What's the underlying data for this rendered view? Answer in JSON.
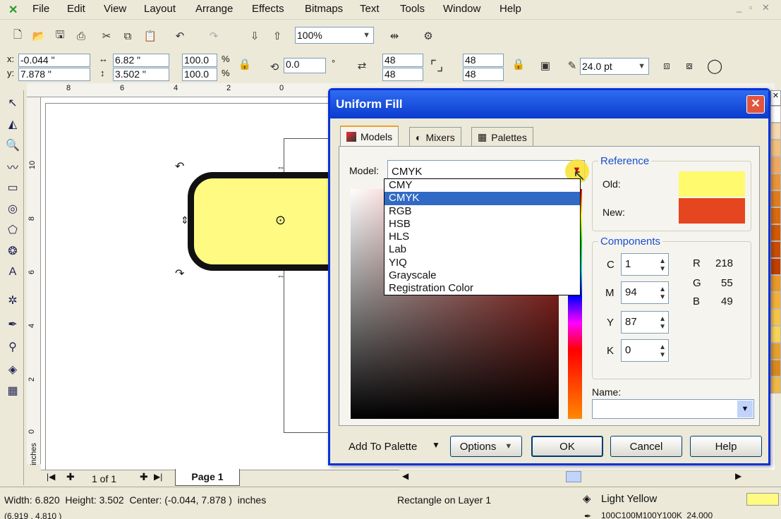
{
  "menu": [
    "File",
    "Edit",
    "View",
    "Layout",
    "Arrange",
    "Effects",
    "Bitmaps",
    "Text",
    "Tools",
    "Window",
    "Help"
  ],
  "toolbar": {
    "zoom": "100%"
  },
  "propbar": {
    "x_label": "x:",
    "x": "-0.044 \"",
    "y_label": "y:",
    "y": "7.878 \"",
    "w": "6.82 \"",
    "h": "3.502 \"",
    "sx": "100.0",
    "sy": "100.0",
    "pct1": "%",
    "pct2": "%",
    "angle": "0.0",
    "deg": "°",
    "c1": "48",
    "c2": "48",
    "c3": "48",
    "c4": "48",
    "outline": "24.0 pt"
  },
  "rulers": {
    "h_ticks": [
      "8",
      "6",
      "4",
      "2",
      "0"
    ],
    "v_ticks": [
      "10",
      "8",
      "6",
      "4",
      "2",
      "0"
    ],
    "unit": "inches"
  },
  "page_nav": {
    "count": "1 of 1",
    "tab": "Page 1"
  },
  "dialog": {
    "title": "Uniform Fill",
    "tabs": [
      "Models",
      "Mixers",
      "Palettes"
    ],
    "model_label": "Model:",
    "model_value": "CMYK",
    "model_options": [
      "CMY",
      "CMYK",
      "RGB",
      "HSB",
      "HLS",
      "Lab",
      "YIQ",
      "Grayscale",
      "Registration Color"
    ],
    "model_selected_index": 1,
    "reference": {
      "title": "Reference",
      "old_label": "Old:",
      "new_label": "New:",
      "old_color": "#fffa6e",
      "new_color": "#e5461f"
    },
    "components": {
      "title": "Components",
      "cmyk": [
        {
          "label": "C",
          "value": "1"
        },
        {
          "label": "M",
          "value": "94"
        },
        {
          "label": "Y",
          "value": "87"
        },
        {
          "label": "K",
          "value": "0"
        }
      ],
      "rgb": [
        {
          "label": "R",
          "value": "218"
        },
        {
          "label": "G",
          "value": "55"
        },
        {
          "label": "B",
          "value": "49"
        }
      ]
    },
    "name_label": "Name:",
    "buttons": {
      "add_to_palette": "Add To Palette",
      "options": "Options",
      "ok": "OK",
      "cancel": "Cancel",
      "help": "Help"
    }
  },
  "status": {
    "dimensions": "Width: 6.820  Height: 3.502  Center: (-0.044, 7.878 )  inches",
    "object": "Rectangle on Layer 1",
    "fill": "Light Yellow",
    "outline": "100C100M100Y100K  24.000",
    "coords": "(6.919 , 4.810 )"
  },
  "colors": {
    "shape_fill": "#fffa82",
    "accent": "#316ac5",
    "title_bar": "#0a3bcf"
  }
}
